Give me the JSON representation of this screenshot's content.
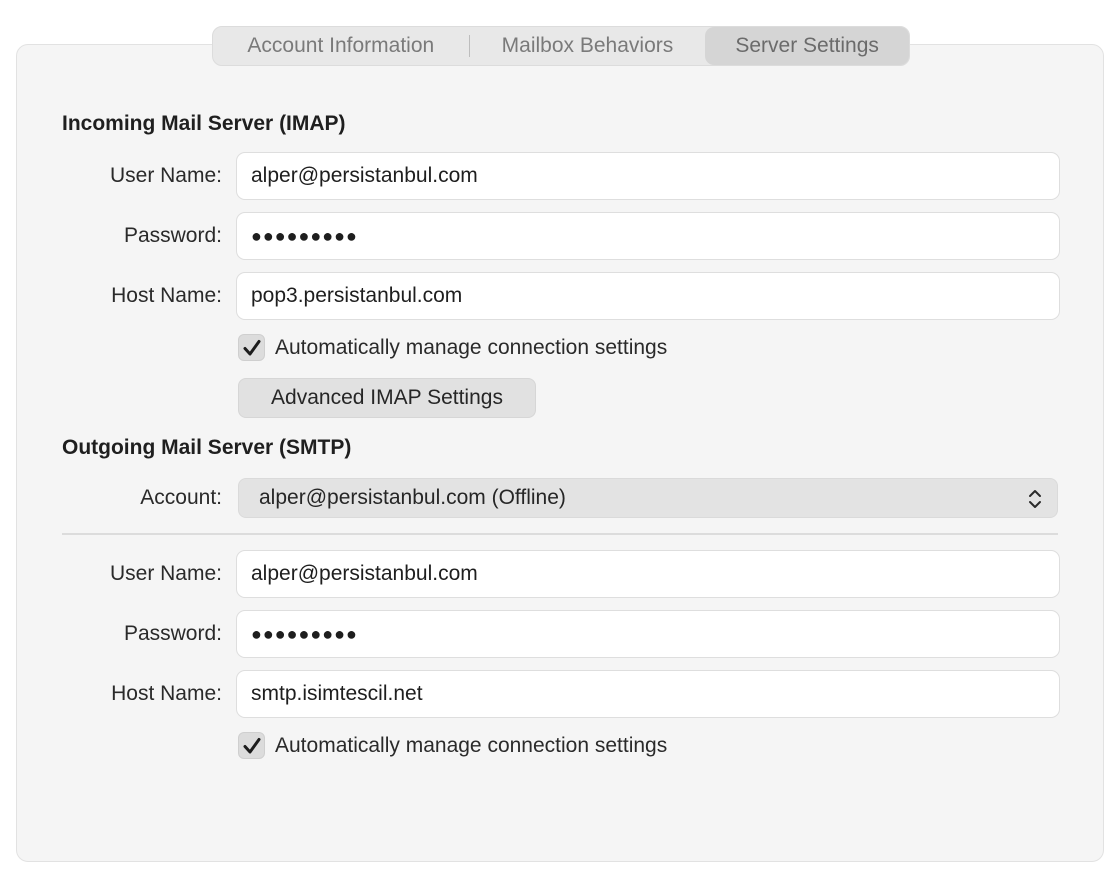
{
  "tabs": [
    {
      "label": "Account Information"
    },
    {
      "label": "Mailbox Behaviors"
    },
    {
      "label": "Server Settings"
    }
  ],
  "incoming": {
    "title": "Incoming Mail Server (IMAP)",
    "user_label": "User Name:",
    "user_value": "alper@persistanbul.com",
    "password_label": "Password:",
    "password_value": "●●●●●●●●●",
    "host_label": "Host Name:",
    "host_value": "pop3.persistanbul.com",
    "auto_label": "Automatically manage connection settings",
    "advanced_button": "Advanced IMAP Settings"
  },
  "outgoing": {
    "title": "Outgoing Mail Server (SMTP)",
    "account_label": "Account:",
    "account_value": "alper@persistanbul.com (Offline)",
    "user_label": "User Name:",
    "user_value": "alper@persistanbul.com",
    "password_label": "Password:",
    "password_value": "●●●●●●●●●",
    "host_label": "Host Name:",
    "host_value": "smtp.isimtescil.net",
    "auto_label": "Automatically manage connection settings"
  }
}
